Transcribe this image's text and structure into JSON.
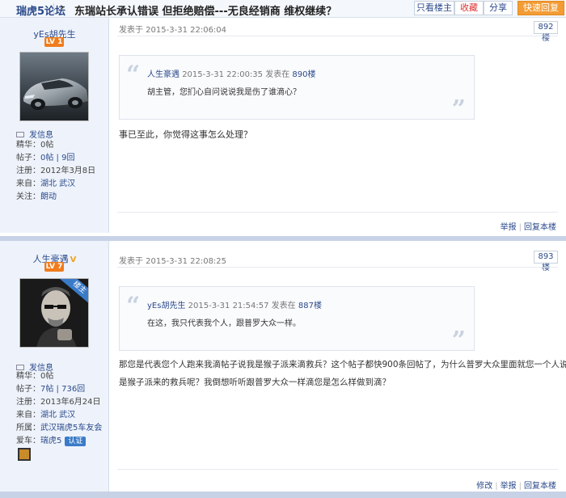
{
  "topbar": {
    "forum_name": "瑞虎5论坛",
    "arrow": "›",
    "thread_title": "东瑞站长承认错误 但拒绝赔偿---无良经销商 维权继续？",
    "only_op_label": "只看楼主",
    "favorite_label": "收藏",
    "share_label": "分享",
    "quick_reply_label": "快速回复"
  },
  "colors": {
    "accent": "#2b4a8b",
    "reply_button": "#f39c35",
    "level_badge": "#f07c1c",
    "sidebar_bg": "#eef3fb"
  },
  "posts": [
    {
      "username": "yEs胡先生",
      "level": "LV 1",
      "message_label": "发信息",
      "info": {
        "essence_k": "精华：",
        "essence_v": "0帖",
        "posts_k": "帖子：",
        "posts_v": "0帖 | 9回",
        "reg_k": "注册：",
        "reg_v": "2012年3月8日",
        "from_k": "来自：",
        "from_v": "湖北 武汉",
        "follow_k": "关注：",
        "follow_v": "朗动"
      },
      "posted_at": "发表于 2015-3-31 22:06:04",
      "floor": "892楼",
      "quote_user": "人生豪遇",
      "quote_time": "2015-3-31 22:00:35 发表在",
      "quote_floor": "890楼",
      "quote_text": "胡主管，您扪心自问说说我是伤了谁滴心？",
      "content": "事已至此，你觉得这事怎么处理？",
      "actions": {
        "report": "举报",
        "reply": "回复本楼"
      }
    },
    {
      "username": "人生豪遇",
      "verified_mark": "V",
      "level": "LV 7",
      "owner_tag": "楼主",
      "message_label": "发信息",
      "info": {
        "essence_k": "精华：",
        "essence_v": "0帖",
        "posts_k": "帖子：",
        "posts_v": "7帖 | 736回",
        "reg_k": "注册：",
        "reg_v": "2013年6月24日",
        "from_k": "来自：",
        "from_v": "湖北 武汉",
        "club_k": "所属：",
        "club_v": "武汉瑞虎5车友会",
        "car_k": "爱车：",
        "car_v": "瑞虎5",
        "auth_badge": "认证"
      },
      "posted_at": "发表于 2015-3-31 22:08:25",
      "floor": "893楼",
      "quote_user": "yEs胡先生",
      "quote_time": "2015-3-31 21:54:57 发表在",
      "quote_floor": "887楼",
      "quote_text": "在这，我只代表我个人，跟普罗大众一样。",
      "content_line1": "那您是代表您个人跑来我滴帖子说我是猴子派来滴救兵？这个帖子都快900条回帖了，为什么普罗大众里面就您一个人说我",
      "content_line2": "是猴子派来的救兵呢？我倒想听听跟普罗大众一样滴您是怎么样做到滴？",
      "actions": {
        "edit": "修改",
        "report": "举报",
        "reply": "回复本楼"
      }
    }
  ]
}
